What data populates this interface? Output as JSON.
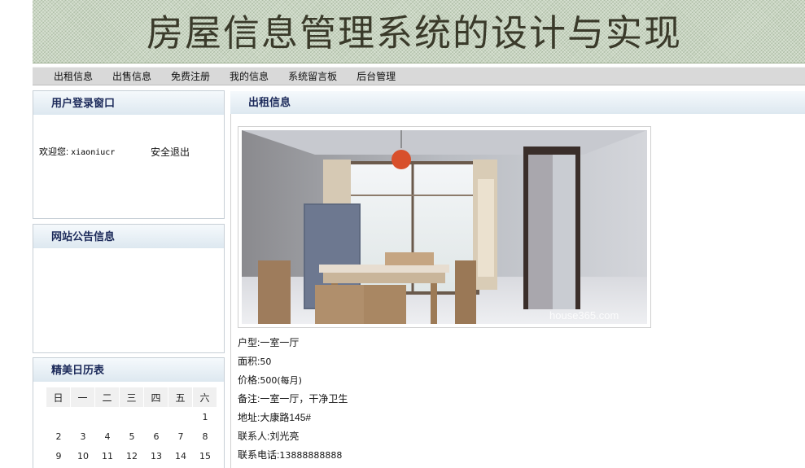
{
  "banner": {
    "title": "房屋信息管理系统的设计与实现"
  },
  "nav": {
    "items": [
      "出租信息",
      "出售信息",
      "免费注册",
      "我的信息",
      "系统留言板",
      "后台管理"
    ]
  },
  "login_panel": {
    "title": "用户登录窗口",
    "welcome_label": "欢迎您:",
    "username": "xiaoniucr",
    "logout": "安全退出"
  },
  "notice_panel": {
    "title": "网站公告信息"
  },
  "calendar_panel": {
    "title": "精美日历表",
    "weekdays": [
      "日",
      "一",
      "二",
      "三",
      "四",
      "五",
      "六"
    ],
    "weeks": [
      [
        "",
        "",
        "",
        "",
        "",
        "",
        "1"
      ],
      [
        "2",
        "3",
        "4",
        "5",
        "6",
        "7",
        "8"
      ],
      [
        "9",
        "10",
        "11",
        "12",
        "13",
        "14",
        "15"
      ]
    ]
  },
  "main": {
    "title": "出租信息",
    "photo_watermark": "house365.com",
    "fields": {
      "type_label": "户型:",
      "type_value": "一室一厅",
      "area_label": "面积:",
      "area_value": "50",
      "price_label": "价格:",
      "price_value": "500(每月)",
      "note_label": "备注:",
      "note_value": "一室一厅，干净卫生",
      "address_label": "地址:",
      "address_value": "大康路145#",
      "contact_label": "联系人:",
      "contact_value": "刘光亮",
      "phone_label": "联系电话:",
      "phone_value": "13888888888"
    }
  }
}
